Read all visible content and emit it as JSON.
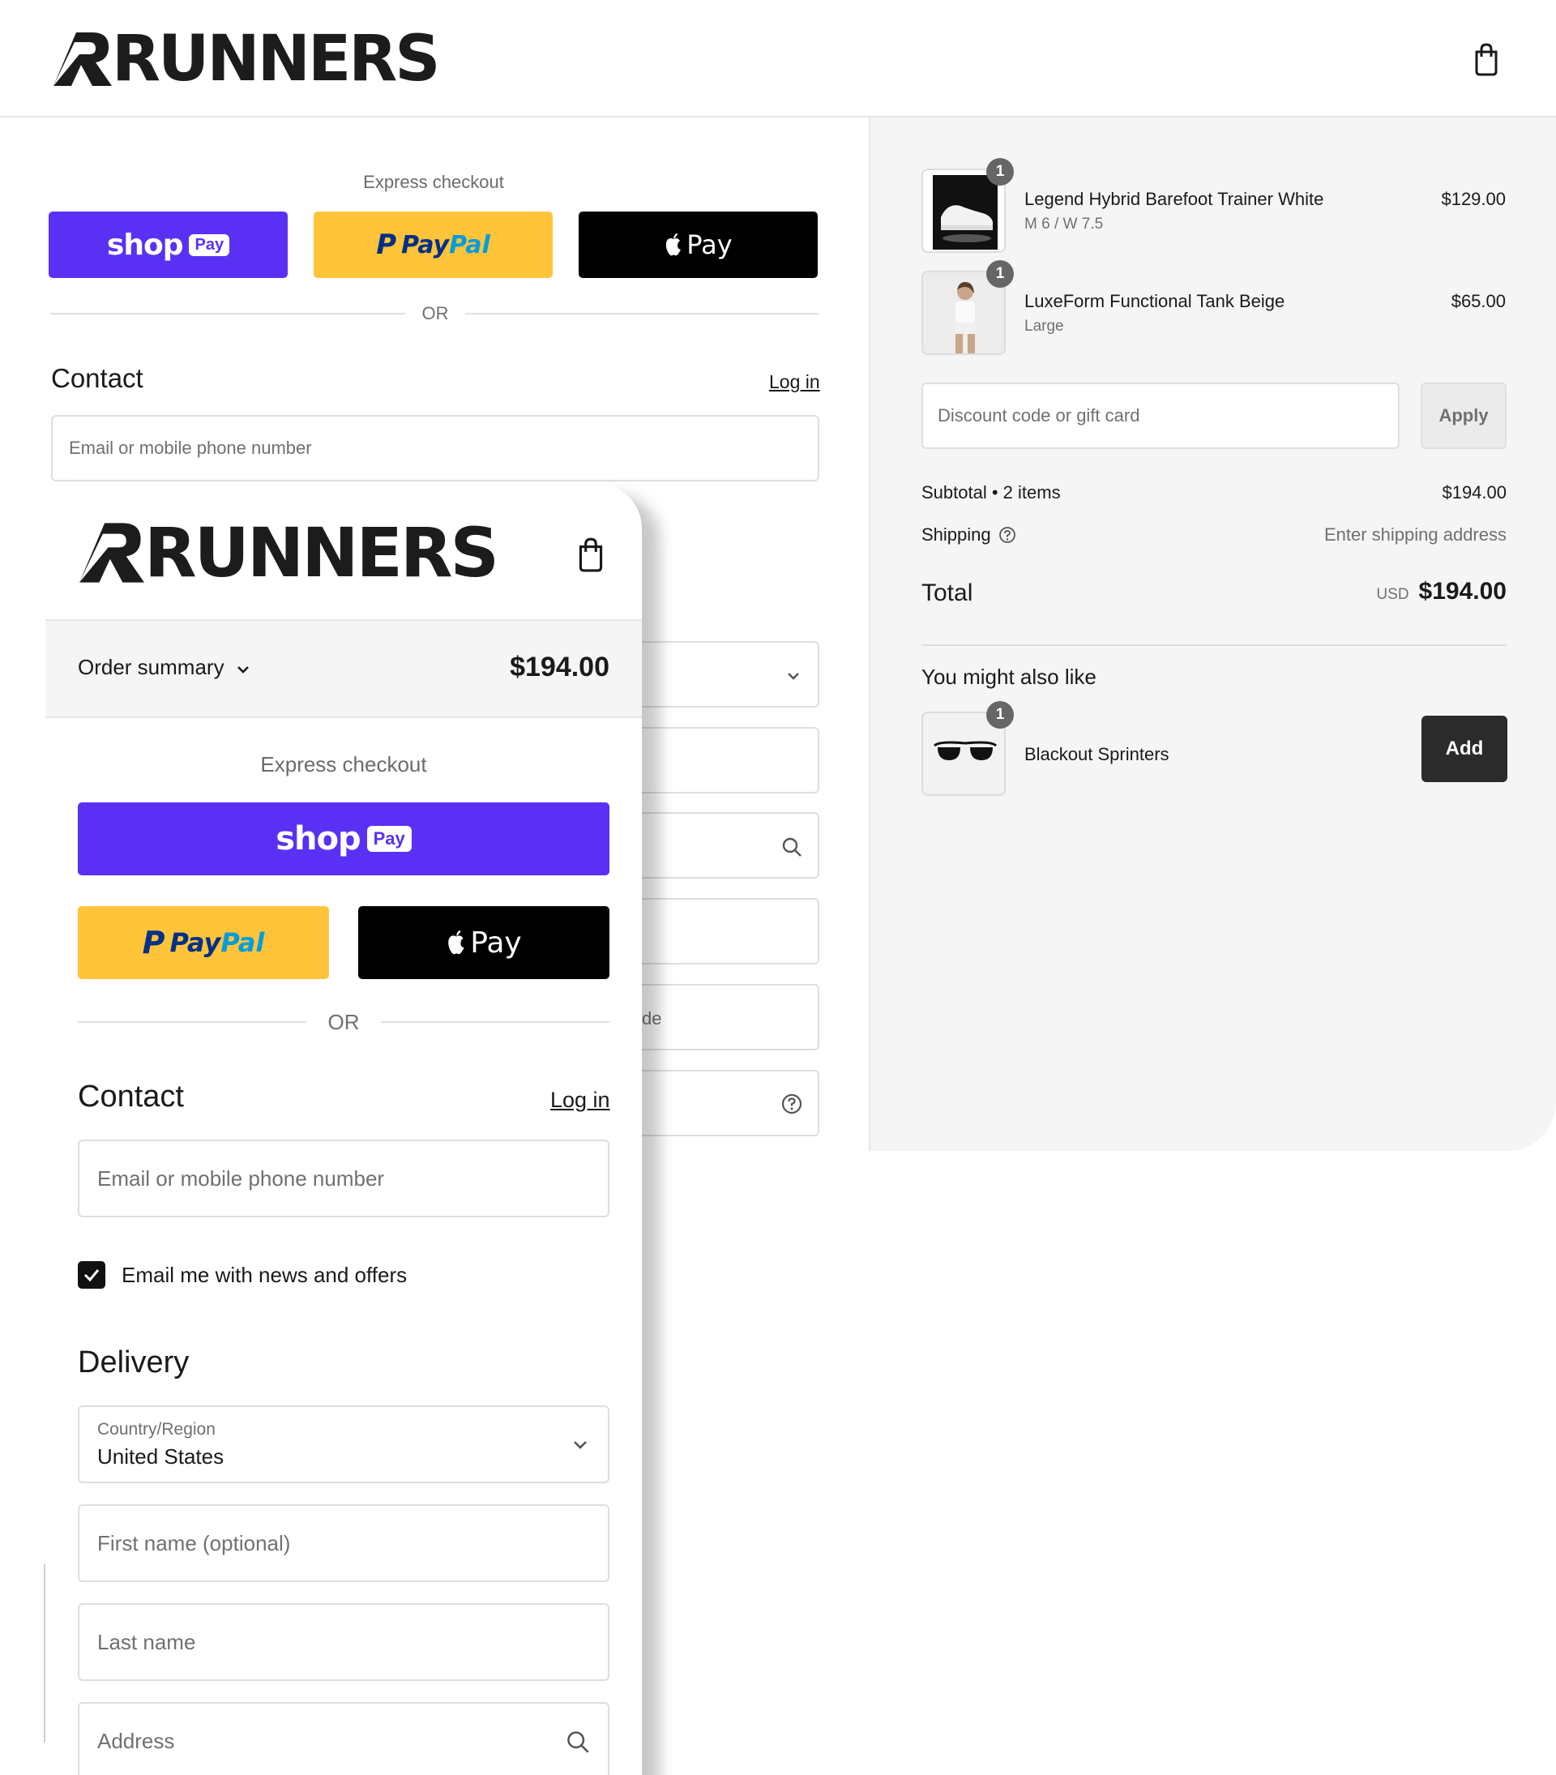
{
  "brand": {
    "name": "RUNNERS"
  },
  "icons": {
    "bag": "shopping-bag-icon",
    "chevron": "chevron-down-icon",
    "search": "search-icon",
    "help": "question-circle-icon",
    "check": "check-icon",
    "apple": "apple-logo-icon"
  },
  "colors": {
    "shop_pay": "#5a31f4",
    "paypal": "#ffc439",
    "apple_pay": "#000000",
    "add_button": "#2b2b2b",
    "badge": "#666666"
  },
  "express": {
    "label": "Express checkout",
    "shop_text": "shop",
    "shop_pill": "Pay",
    "paypal_pay": "Pay",
    "paypal_pal": "Pal",
    "apple_text": "Pay",
    "or": "OR"
  },
  "contact": {
    "title": "Contact",
    "login": "Log in",
    "email_placeholder": "Email or mobile phone number",
    "newsletter_label": "Email me with news and offers"
  },
  "delivery": {
    "title": "Delivery",
    "country_label": "Country/Region",
    "country_value": "United States",
    "first_name_placeholder": "First name (optional)",
    "last_name_placeholder": "Last name",
    "address_placeholder": "Address",
    "partial_apartment_hint": "de"
  },
  "order_summary": {
    "toggle_label": "Order summary",
    "total": "$194.00",
    "items": [
      {
        "name": "Legend Hybrid Barefoot Trainer White",
        "variant": "M 6 / W 7.5",
        "price": "$129.00",
        "qty": "1"
      },
      {
        "name": "LuxeForm Functional Tank Beige",
        "variant": "Large",
        "price": "$65.00",
        "qty": "1"
      }
    ],
    "discount_placeholder": "Discount code or gift card",
    "apply_label": "Apply",
    "subtotal_label": "Subtotal • 2 items",
    "subtotal_value": "$194.00",
    "shipping_label": "Shipping",
    "shipping_value": "Enter shipping address",
    "total_label": "Total",
    "currency": "USD",
    "total_value": "$194.00"
  },
  "upsell": {
    "title": "You might also like",
    "item_name": "Blackout Sprinters",
    "qty": "1",
    "add_label": "Add"
  }
}
